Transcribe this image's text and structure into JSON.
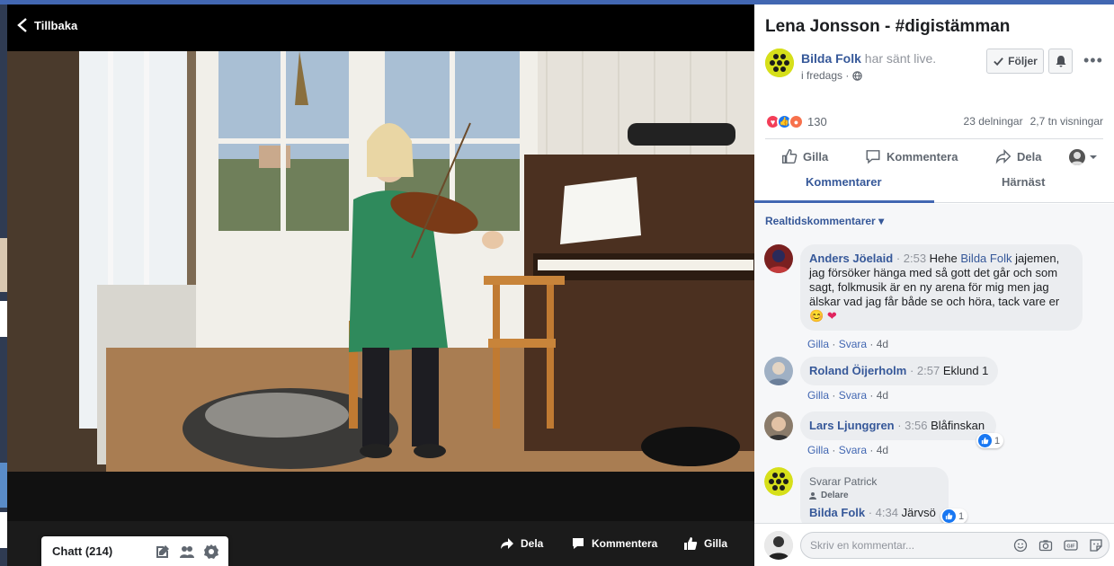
{
  "player": {
    "back_label": "Tillbaka",
    "controls": {
      "share": "Dela",
      "comment": "Kommentera",
      "like": "Gilla"
    }
  },
  "chat": {
    "label": "Chatt (214)"
  },
  "post": {
    "title": "Lena Jonsson - #digistämman",
    "page_name": "Bilda Folk",
    "action_text": " har sänt live.",
    "time": "i fredags ·",
    "follow_label": "Följer",
    "reaction_count": "130",
    "shares": "23 delningar",
    "views": "2,7 tn visningar"
  },
  "actions": {
    "like": "Gilla",
    "comment": "Kommentera",
    "share": "Dela"
  },
  "tabs": {
    "comments": "Kommentarer",
    "next": "Härnäst"
  },
  "filter_label": "Realtidskommentarer",
  "comments": [
    {
      "author": "Anders Jöelaid",
      "ts": " · 2:53 ",
      "pre": "Hehe ",
      "mention": "Bilda Folk",
      "text": " jajemen, jag försöker hänga med så gott det går och som sagt, folkmusik är en ny arena för mig men jag älskar vad jag får både se och höra, tack vare er",
      "like": "Gilla",
      "reply": "Svara",
      "age": "4d"
    },
    {
      "author": "Roland Öijerholm",
      "ts": " · 2:57 ",
      "text": "Eklund 1",
      "like": "Gilla",
      "reply": "Svara",
      "age": "4d"
    },
    {
      "author": "Lars Ljunggren",
      "ts": " · 3:56 ",
      "text": "Blåfinskan",
      "likes": "1",
      "like": "Gilla",
      "reply": "Svara",
      "age": "4d"
    },
    {
      "reply_to": "Svarar Patrick",
      "shared_label": "Delare",
      "author": "Bilda Folk",
      "ts": " · 4:34 ",
      "text": "Järvsö",
      "likes": "1"
    }
  ],
  "composer": {
    "placeholder": "Skriv en kommentar..."
  },
  "colors": {
    "brand_blue": "#4267b2",
    "link": "#365899",
    "page_logo": "#d6df1a"
  }
}
